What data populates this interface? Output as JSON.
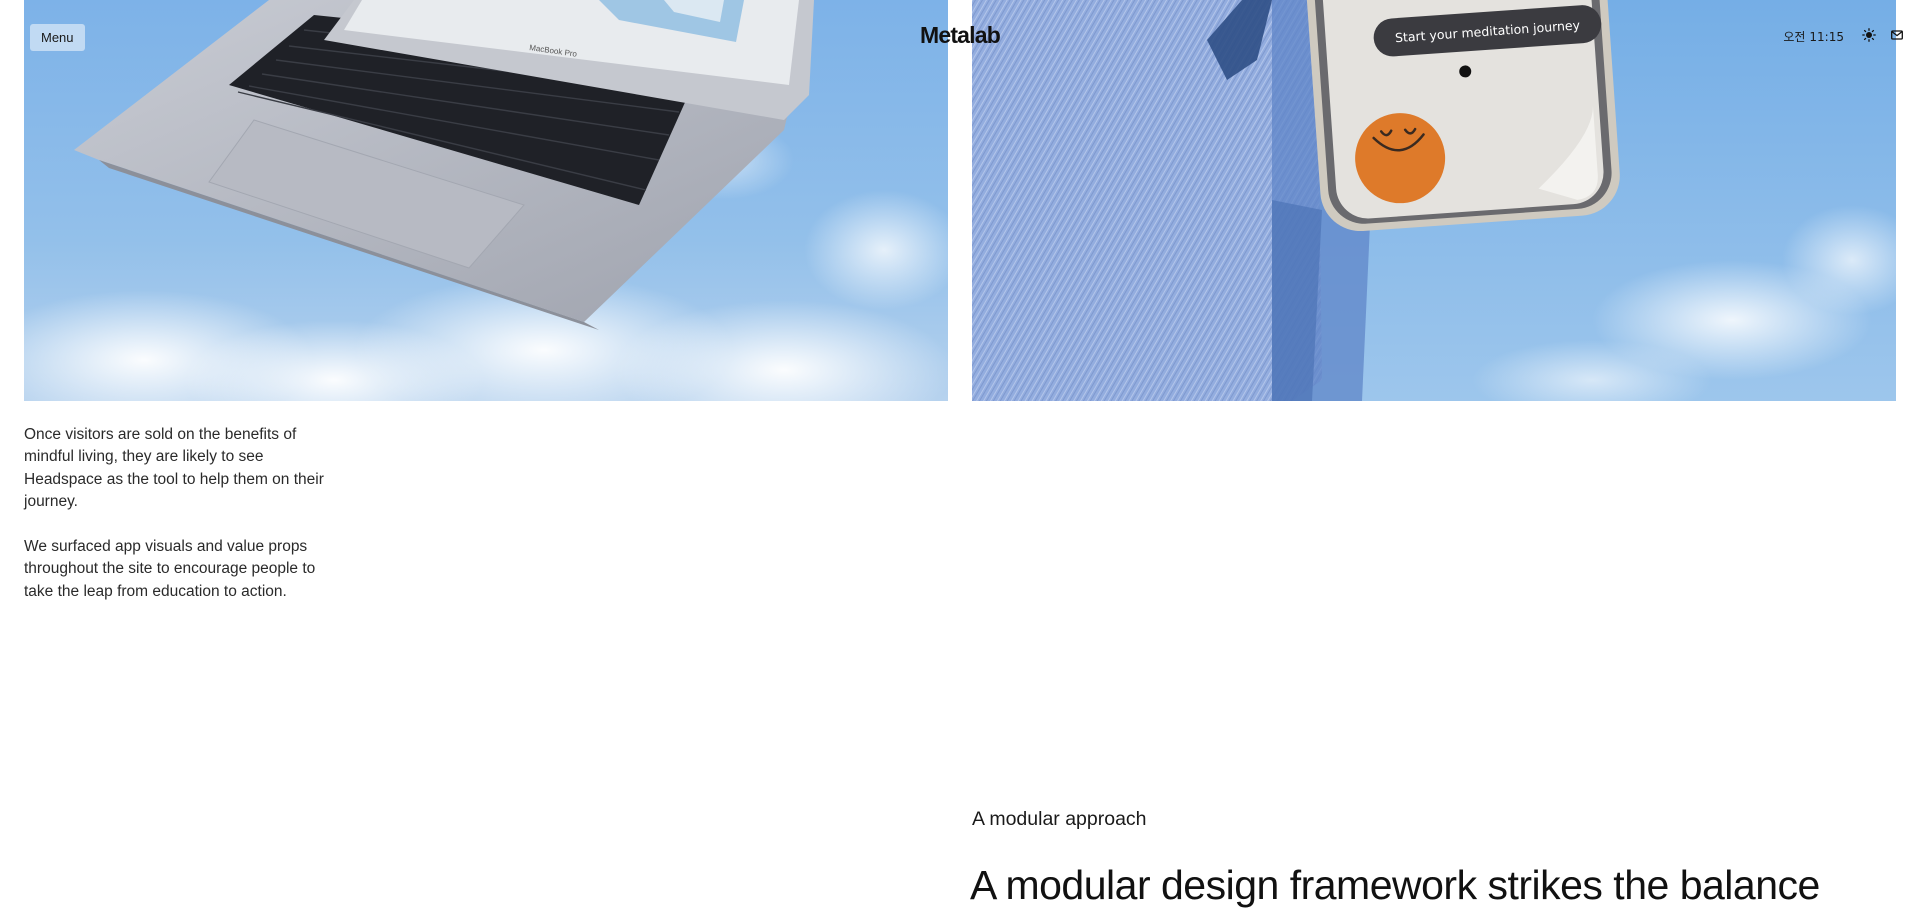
{
  "header": {
    "menu_label": "Menu",
    "logo_text": "Metalab",
    "clock_period": "오전",
    "clock_time": "11:15",
    "theme_icon": "sun-icon",
    "contact_icon": "mail-icon"
  },
  "images": {
    "left": {
      "device_label": "MacBook Pro"
    },
    "right": {
      "phone_button_text": "Start your meditation journey"
    }
  },
  "copy": {
    "paragraph_1": "Once visitors are sold on the benefits of mindful living, they are likely to see Headspace as the tool to help them on their journey.",
    "paragraph_2": "We surfaced app visuals and value props throughout the site to encourage people to take the leap from education to action."
  },
  "section": {
    "label": "A modular approach",
    "headline": "A modular design framework strikes the balance"
  },
  "colors": {
    "sky": "#8fbbe6",
    "denim": "#8aa9de",
    "headspace_orange": "#de7a2a",
    "phone_button": "#3b3b40"
  }
}
